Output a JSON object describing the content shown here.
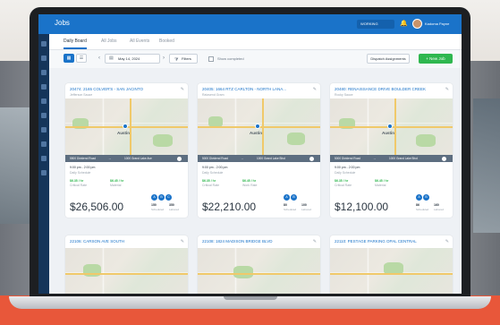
{
  "app": {
    "title": "Jobs",
    "dropdown": "WORKING",
    "user": "Kadoma Payne"
  },
  "tabs": [
    "Daily Board",
    "All Jobs",
    "All Events",
    "Booked"
  ],
  "toolbar": {
    "date": "May 14, 2024",
    "filters": "Filters",
    "checkbox_label": "Show completed",
    "dispatch": "Dispatch Assignments",
    "new_job": "+ New Job"
  },
  "cards": [
    {
      "title": "20474: 2165 COLVER'S - SAN JACINTO",
      "subtitle": "Jefferson Sauce",
      "city": "Austin",
      "route_start": "5500 Dividend Road",
      "route_end": "1000 Grand Lake Ave",
      "time": "9:00 pm - 2:00 pm",
      "type": "Daily Schedule",
      "rate1": "$6.35 / hr",
      "rate1_label": "Critical Rate",
      "rate2": "$6.45 / hr",
      "rate2_label": "Material",
      "techs": [
        "A",
        "B",
        "C"
      ],
      "price": "$26,506.00",
      "stat1": "150",
      "stat1_label": "Scheduled",
      "stat2": "350",
      "stat2_label": "Labored"
    },
    {
      "title": "20405: 1664 RTZ CARLTON - NORTH LANA...",
      "subtitle": "Ratzsend Gram",
      "city": "Austin",
      "route_start": "5000 Dividend Road",
      "route_end": "1000 Grand Lake Blvd",
      "time": "9:00 pm - 2:00 pm",
      "type": "Daily Schedule",
      "rate1": "$6.35 / hr",
      "rate1_label": "Critical Rate",
      "rate2": "$6.45 / hr",
      "rate2_label": "Work Rate",
      "techs": [
        "A",
        "B"
      ],
      "price": "$22,210.00",
      "stat1": "80",
      "stat1_label": "Scheduled",
      "stat2": "100",
      "stat2_label": "Labored"
    },
    {
      "title": "20480: RENAISSANCE DRIVE BOULDER CREEK",
      "subtitle": "Rocky Sauce",
      "city": "Austin",
      "route_start": "5000 Dividend Road",
      "route_end": "1000 Grand Lake Blvd",
      "time": "9:00 pm - 2:00 pm",
      "type": "Daily Schedule",
      "rate1": "$6.35 / hr",
      "rate1_label": "Critical Rate",
      "rate2": "$6.45 / hr",
      "rate2_label": "Material",
      "techs": [
        "A",
        "B"
      ],
      "price": "$12,100.00",
      "stat1": "86",
      "stat1_label": "Scheduled",
      "stat2": "160",
      "stat2_label": "Labored"
    },
    {
      "title": "22106: CARSON AVE SOUTH",
      "subtitle": ""
    },
    {
      "title": "22108: 1824 MADISON BRIDGE BLVD",
      "subtitle": ""
    },
    {
      "title": "22110: PESTAGE PARKING OPAL CENTRAL",
      "subtitle": ""
    }
  ],
  "colors": {
    "accent": "#1a73c9",
    "success": "#2fb74f",
    "sidebar": "#15355a",
    "background_red": "#e8573a"
  },
  "icons": [
    "bell-icon",
    "calendar-icon",
    "filter-icon",
    "grid-view-icon",
    "list-view-icon",
    "pencil-icon",
    "chevron-left-icon",
    "chevron-right-icon"
  ]
}
